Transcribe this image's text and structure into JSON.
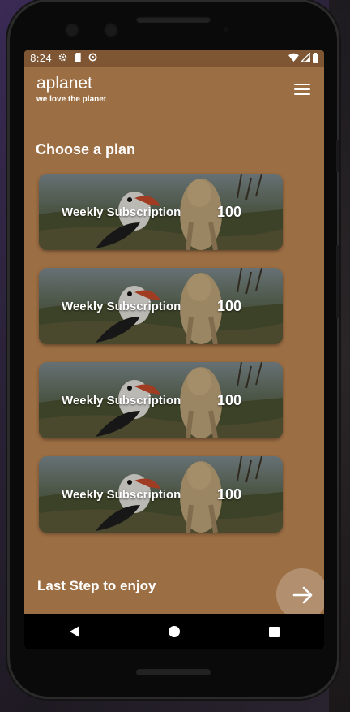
{
  "status_bar": {
    "time": "8:24",
    "icons_left": [
      "gear-icon",
      "sd-card-icon",
      "data-saver-icon"
    ],
    "icons_right": [
      "wifi-icon",
      "signal-icon",
      "battery-icon"
    ]
  },
  "app": {
    "title": "aplanet",
    "subtitle": "we love the planet",
    "menu_icon": "hamburger-menu-icon"
  },
  "section_title": "Choose a plan",
  "plans": [
    {
      "name": "Weekly Subscription",
      "price": "100"
    },
    {
      "name": "Weekly Subscription",
      "price": "100"
    },
    {
      "name": "Weekly Subscription",
      "price": "100"
    },
    {
      "name": "Weekly Subscription",
      "price": "100"
    }
  ],
  "footer": {
    "text": "Last Step to enjoy",
    "next_icon": "arrow-right-icon"
  },
  "nav": [
    "back-icon",
    "home-icon",
    "recents-icon"
  ],
  "colors": {
    "screen_bg": "#9c6e44",
    "status_bar_bg": "#7e5634",
    "accent_button": "#b2906f"
  }
}
